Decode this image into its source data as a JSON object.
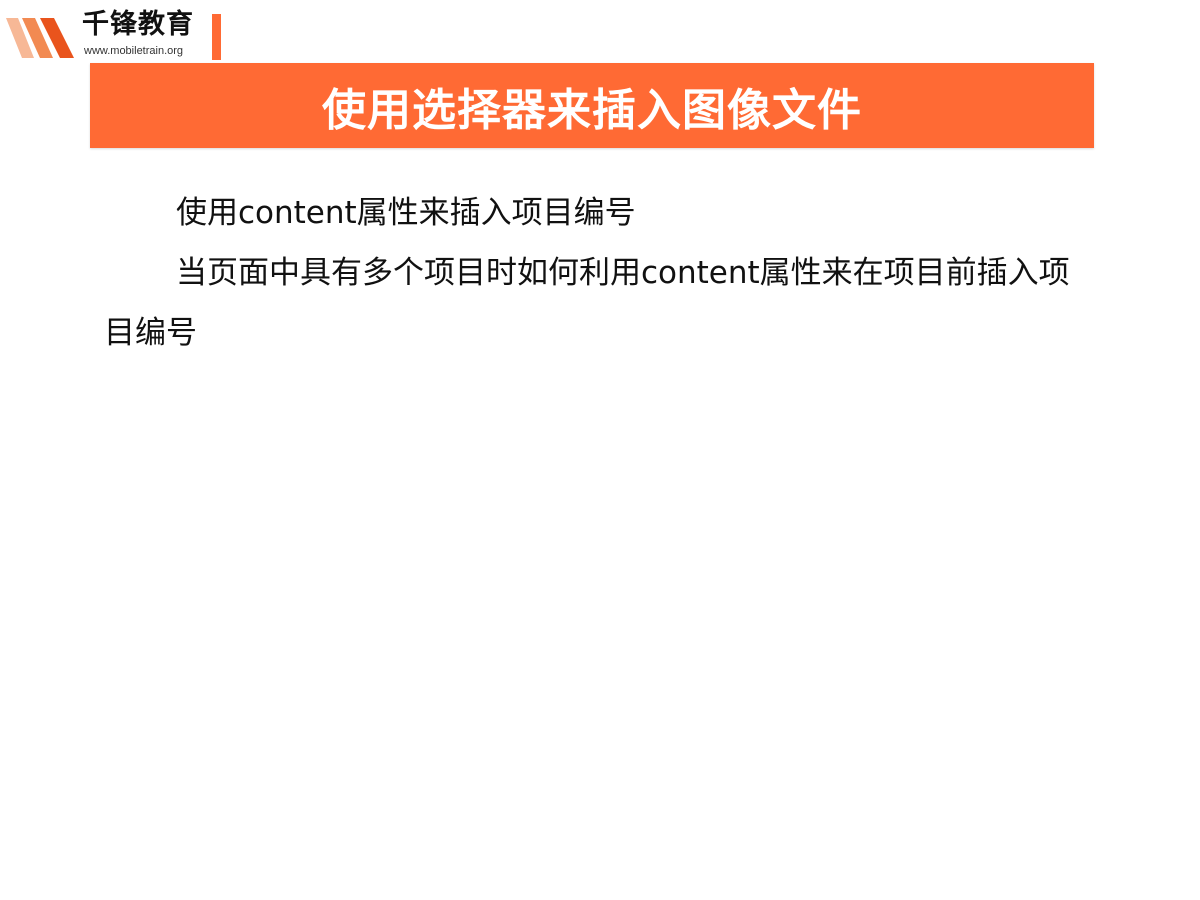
{
  "logo": {
    "name": "千锋教育",
    "url": "www.mobiletrain.org",
    "icon": "logo-stripes-icon",
    "accent_color": "#ff6a34",
    "stripe_colors": [
      "#f7b896",
      "#f28a52",
      "#e9541d"
    ]
  },
  "slide": {
    "title": "使用选择器来插入图像文件",
    "title_bg_color": "#ff6a34",
    "paragraphs": [
      "使用content属性来插入项目编号",
      "当页面中具有多个项目时如何利用content属性来在项目前插入项目编号"
    ]
  }
}
